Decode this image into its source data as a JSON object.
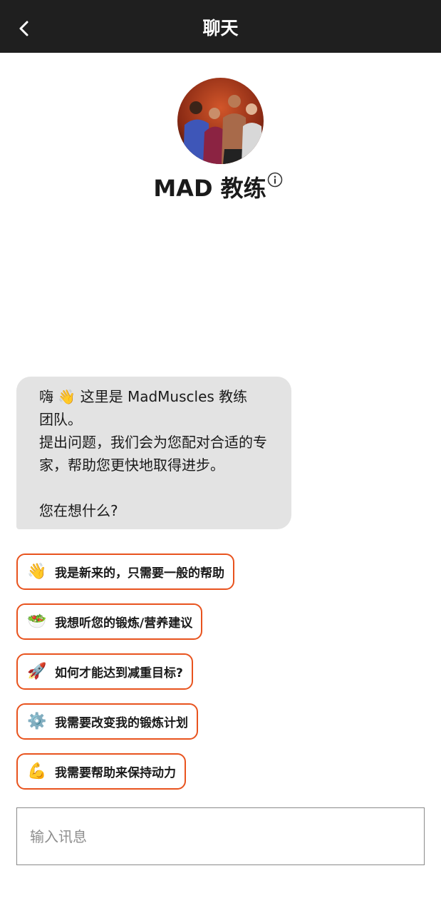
{
  "header": {
    "title": "聊天",
    "back_icon": "chevron-left-icon"
  },
  "coach": {
    "name": "MAD 教练",
    "info_icon": "info-circle-icon"
  },
  "message": {
    "line1": "嗨 👋 这里是 MadMuscles 教练",
    "line2": "团队。",
    "line3": "提出问题，我们会为您配对合适的专",
    "line4": "家，帮助您更快地取得进步。",
    "line5": "您在想什么?"
  },
  "options": [
    {
      "emoji": "👋",
      "label": "我是新来的，只需要一般的帮助"
    },
    {
      "emoji": "🥗",
      "label": "我想听您的锻炼/营养建议"
    },
    {
      "emoji": "🚀",
      "label": "如何才能达到减重目标?"
    },
    {
      "emoji": "⚙️",
      "label": "我需要改变我的锻炼计划"
    },
    {
      "emoji": "💪",
      "label": "我需要帮助来保持动力"
    }
  ],
  "composer": {
    "placeholder": "输入讯息",
    "value": ""
  },
  "colors": {
    "header_bg": "#1f1f1f",
    "bubble_bg": "#e3e3e3",
    "accent": "#e8531e"
  }
}
